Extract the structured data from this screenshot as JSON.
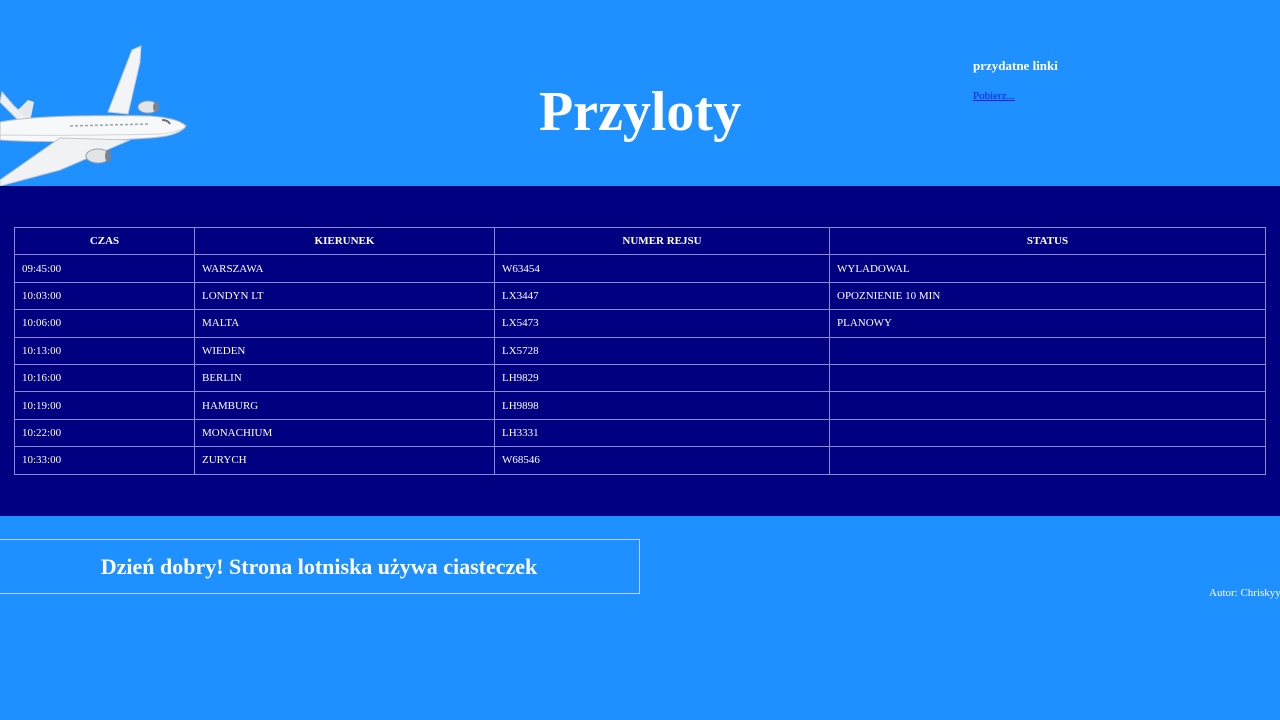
{
  "header": {
    "title": "Przyloty",
    "links_heading": "przydatne linki",
    "links": [
      {
        "label": "Pobierz..."
      }
    ]
  },
  "table": {
    "columns": [
      "CZAS",
      "KIERUNEK",
      "NUMER REJSU",
      "STATUS"
    ],
    "rows": [
      [
        "09:45:00",
        "WARSZAWA",
        "W63454",
        "WYLADOWAL"
      ],
      [
        "10:03:00",
        "LONDYN LT",
        "LX3447",
        "OPOZNIENIE 10 MIN"
      ],
      [
        "10:06:00",
        "MALTA",
        "LX5473",
        "PLANOWY"
      ],
      [
        "10:13:00",
        "WIEDEN",
        "LX5728",
        ""
      ],
      [
        "10:16:00",
        "BERLIN",
        "LH9829",
        ""
      ],
      [
        "10:19:00",
        "HAMBURG",
        "LH9898",
        ""
      ],
      [
        "10:22:00",
        "MONACHIUM",
        "LH3331",
        ""
      ],
      [
        "10:33:00",
        "ZURYCH",
        "W68546",
        ""
      ]
    ]
  },
  "cookie_banner": {
    "text": "Dzień dobry! Strona lotniska używa ciasteczek"
  },
  "footer": {
    "author": "Autor: Chriskyy"
  },
  "icons": {
    "logo": "airplane-icon"
  },
  "colors": {
    "page_bg": "#1e90ff",
    "table_bg": "#000080",
    "link": "#1a1adc"
  }
}
